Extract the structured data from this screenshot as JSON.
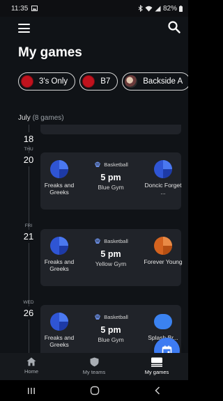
{
  "status": {
    "time": "11:35",
    "battery": "82%"
  },
  "header": {
    "title": "My games"
  },
  "chips": [
    {
      "label": "3's Only"
    },
    {
      "label": "B7"
    },
    {
      "label": "Backside A"
    }
  ],
  "month": {
    "name": "July",
    "count": "(8 games)"
  },
  "days": [
    {
      "dow": "",
      "num": "18"
    },
    {
      "dow": "THU",
      "num": "20"
    },
    {
      "dow": "FRI",
      "num": "21"
    },
    {
      "dow": "WED",
      "num": "26"
    }
  ],
  "games": [
    {
      "sport": "Basketball",
      "time": "5 pm",
      "venue": "Blue Gym",
      "home": "Freaks and Greeks",
      "away": "Doncic Forget ..."
    },
    {
      "sport": "Basketball",
      "time": "5 pm",
      "venue": "Yellow Gym",
      "home": "Freaks and Greeks",
      "away": "Forever Young"
    },
    {
      "sport": "Basketball",
      "time": "5 pm",
      "venue": "Blue Gym",
      "home": "Freaks and Greeks",
      "away": "Splash Br..."
    }
  ],
  "nav": {
    "home": "Home",
    "teams": "My teams",
    "games": "My games"
  },
  "colors": {
    "accent": "#3d7bf2",
    "chip_team": "#c0121d",
    "card": "#202329"
  }
}
